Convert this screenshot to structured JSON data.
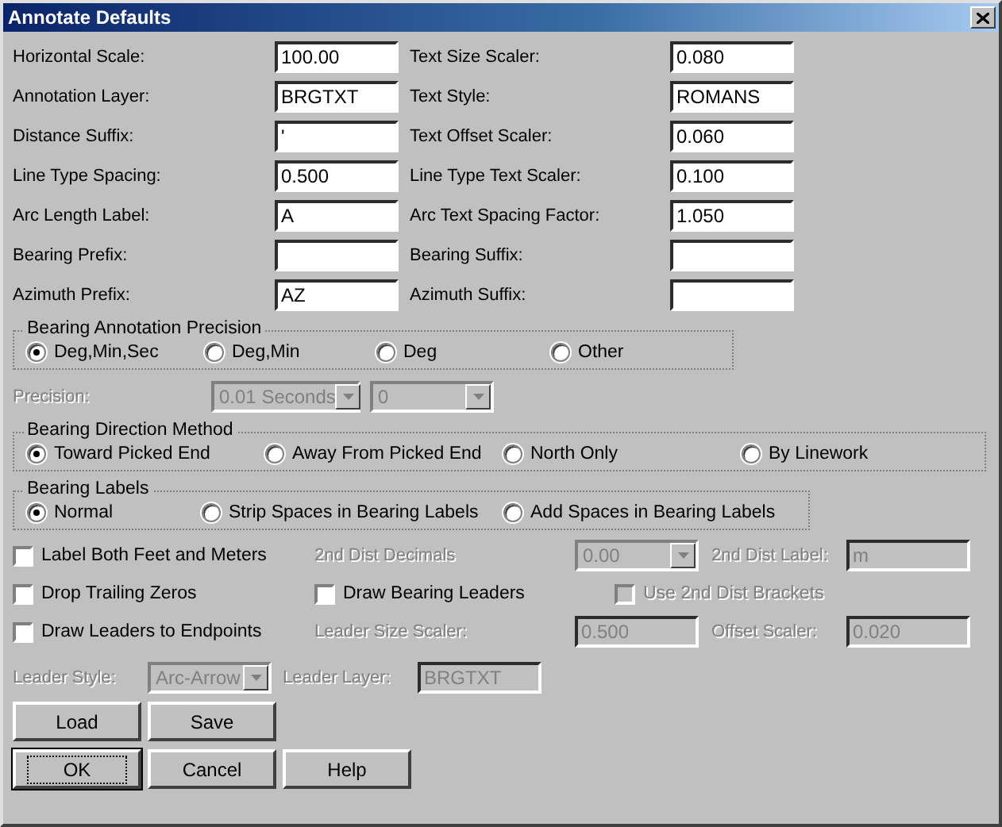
{
  "window": {
    "title": "Annotate Defaults"
  },
  "fields": [
    {
      "label": "Horizontal Scale:",
      "value": "100.00"
    },
    {
      "label": "Text Size Scaler:",
      "value": "0.080"
    },
    {
      "label": "Annotation Layer:",
      "value": "BRGTXT"
    },
    {
      "label": "Text Style:",
      "value": "ROMANS"
    },
    {
      "label": "Distance Suffix:",
      "value": "'"
    },
    {
      "label": "Text Offset Scaler:",
      "value": "0.060"
    },
    {
      "label": "Line Type Spacing:",
      "value": "0.500"
    },
    {
      "label": "Line Type Text Scaler:",
      "value": "0.100"
    },
    {
      "label": "Arc Length Label:",
      "value": "A"
    },
    {
      "label": "Arc Text Spacing Factor:",
      "value": "1.050"
    },
    {
      "label": "Bearing Prefix:"
    },
    {
      "label": "Bearing Suffix:"
    },
    {
      "label": "Azimuth Prefix:",
      "value": "AZ"
    },
    {
      "label": "Azimuth Suffix:"
    }
  ],
  "groups": [
    {
      "title": "Bearing Annotation Precision",
      "options": [
        {
          "label": "Deg,Min,Sec",
          "selected": true
        },
        {
          "label": "Deg,Min",
          "selected": false
        },
        {
          "label": "Deg",
          "selected": false
        },
        {
          "label": "Other",
          "selected": false
        }
      ]
    },
    {
      "kind": "precision",
      "label": "Precision:",
      "disabled": true,
      "combos": [
        {
          "value": "0.01 Seconds"
        },
        {
          "value": "0"
        }
      ]
    },
    {
      "title": "Bearing Direction Method",
      "options": [
        {
          "label": "Toward Picked End",
          "selected": true
        },
        {
          "label": "Away From Picked End",
          "selected": false
        },
        {
          "label": "North Only",
          "selected": false
        },
        {
          "label": "By Linework",
          "selected": false
        }
      ]
    },
    {
      "title": "Bearing Labels",
      "options": [
        {
          "label": "Normal",
          "selected": true
        },
        {
          "label": "Strip Spaces in Bearing Labels",
          "selected": false
        },
        {
          "label": "Add Spaces in Bearing Labels",
          "selected": false
        }
      ]
    }
  ],
  "option_rows": [
    [
      {
        "kind": "checkbox",
        "label": "Label Both Feet and Meters",
        "checked": false,
        "disabled": false
      },
      {
        "kind": "label",
        "label": "2nd Dist Decimals",
        "disabled": true
      },
      {
        "kind": "combo",
        "value": "0.00",
        "disabled": true
      },
      {
        "kind": "label",
        "label": "2nd Dist Label:",
        "disabled": true
      },
      {
        "kind": "field",
        "value": "m",
        "disabled": true
      }
    ],
    [
      {
        "kind": "checkbox",
        "label": "Drop Trailing Zeros",
        "checked": false,
        "disabled": false
      },
      {
        "kind": "checkbox",
        "label": "Draw Bearing Leaders",
        "checked": false,
        "disabled": false
      },
      {
        "kind": "checkbox",
        "label": "Use 2nd Dist Brackets",
        "checked": false,
        "disabled": true
      }
    ],
    [
      {
        "kind": "checkbox",
        "label": "Draw Leaders to Endpoints",
        "checked": false,
        "disabled": false
      },
      {
        "kind": "label",
        "label": "Leader Size Scaler:",
        "disabled": true
      },
      {
        "kind": "field",
        "value": "0.500",
        "disabled": true
      },
      {
        "kind": "label",
        "label": "Offset Scaler:",
        "disabled": true
      },
      {
        "kind": "field",
        "value": "0.020",
        "disabled": true
      }
    ],
    [
      {
        "kind": "label",
        "label": "Leader Style:",
        "disabled": true
      },
      {
        "kind": "combo",
        "value": "Arc-Arrow",
        "disabled": true
      },
      {
        "kind": "label",
        "label": "Leader Layer:",
        "disabled": true
      },
      {
        "kind": "field",
        "value": "BRGTXT",
        "disabled": true
      }
    ]
  ],
  "button_rows": [
    [
      {
        "label": "Load",
        "default": false
      },
      {
        "label": "Save",
        "default": false
      }
    ],
    [
      {
        "label": "OK",
        "default": true
      },
      {
        "label": "Cancel",
        "default": false
      },
      {
        "label": "Help",
        "default": false
      }
    ]
  ]
}
